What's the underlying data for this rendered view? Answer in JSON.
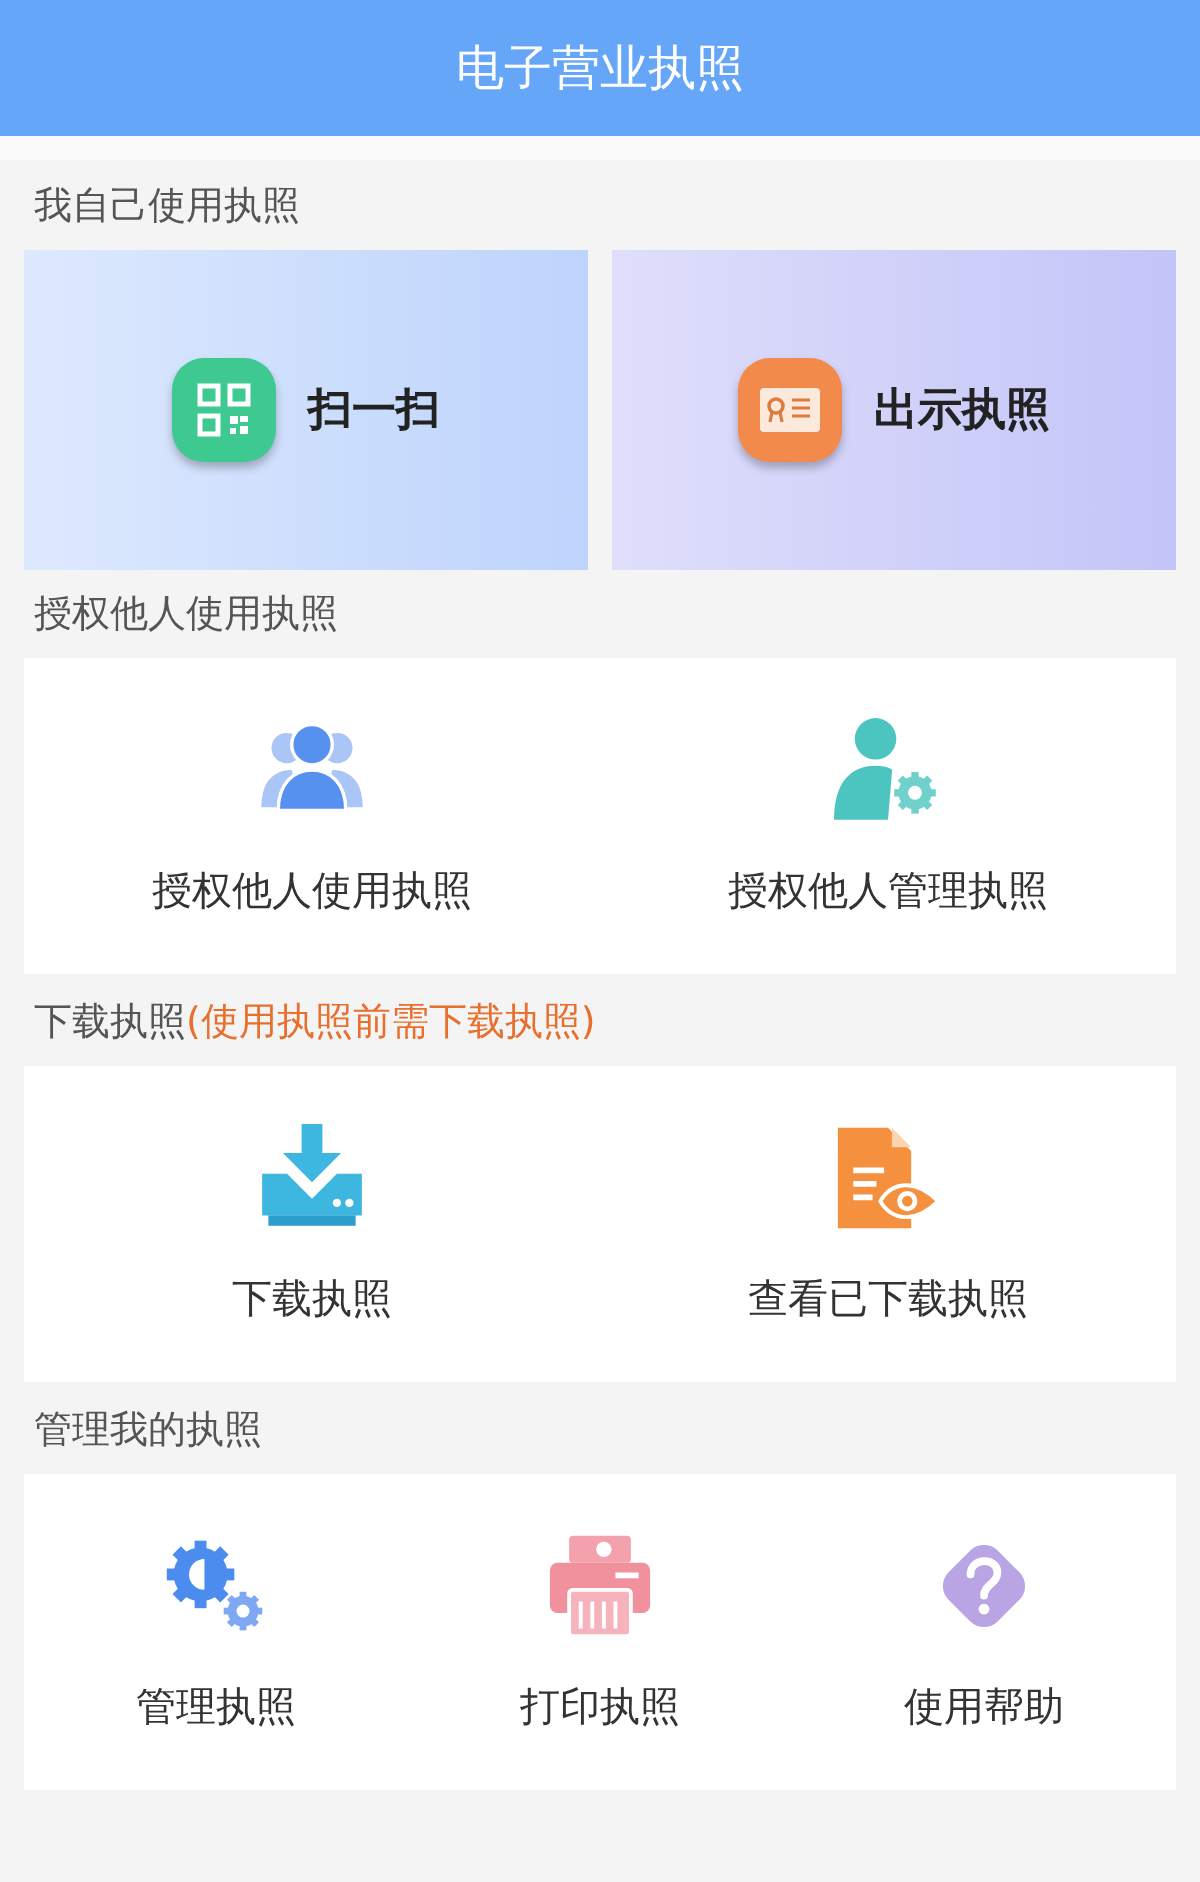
{
  "header": {
    "title": "电子营业执照"
  },
  "sections": [
    {
      "kind": "hero",
      "title": "我自己使用执照",
      "items": [
        {
          "label": "扫一扫"
        },
        {
          "label": "出示执照"
        }
      ]
    },
    {
      "kind": "grid",
      "title": "授权他人使用执照",
      "items": [
        {
          "label": "授权他人使用执照"
        },
        {
          "label": "授权他人管理执照"
        }
      ]
    },
    {
      "kind": "grid",
      "title": "下载执照",
      "note": "(使用执照前需下载执照)",
      "items": [
        {
          "label": "下载执照"
        },
        {
          "label": "查看已下载执照"
        }
      ]
    },
    {
      "kind": "grid",
      "title": "管理我的执照",
      "items": [
        {
          "label": "管理执照"
        },
        {
          "label": "打印执照"
        },
        {
          "label": "使用帮助"
        }
      ]
    }
  ]
}
